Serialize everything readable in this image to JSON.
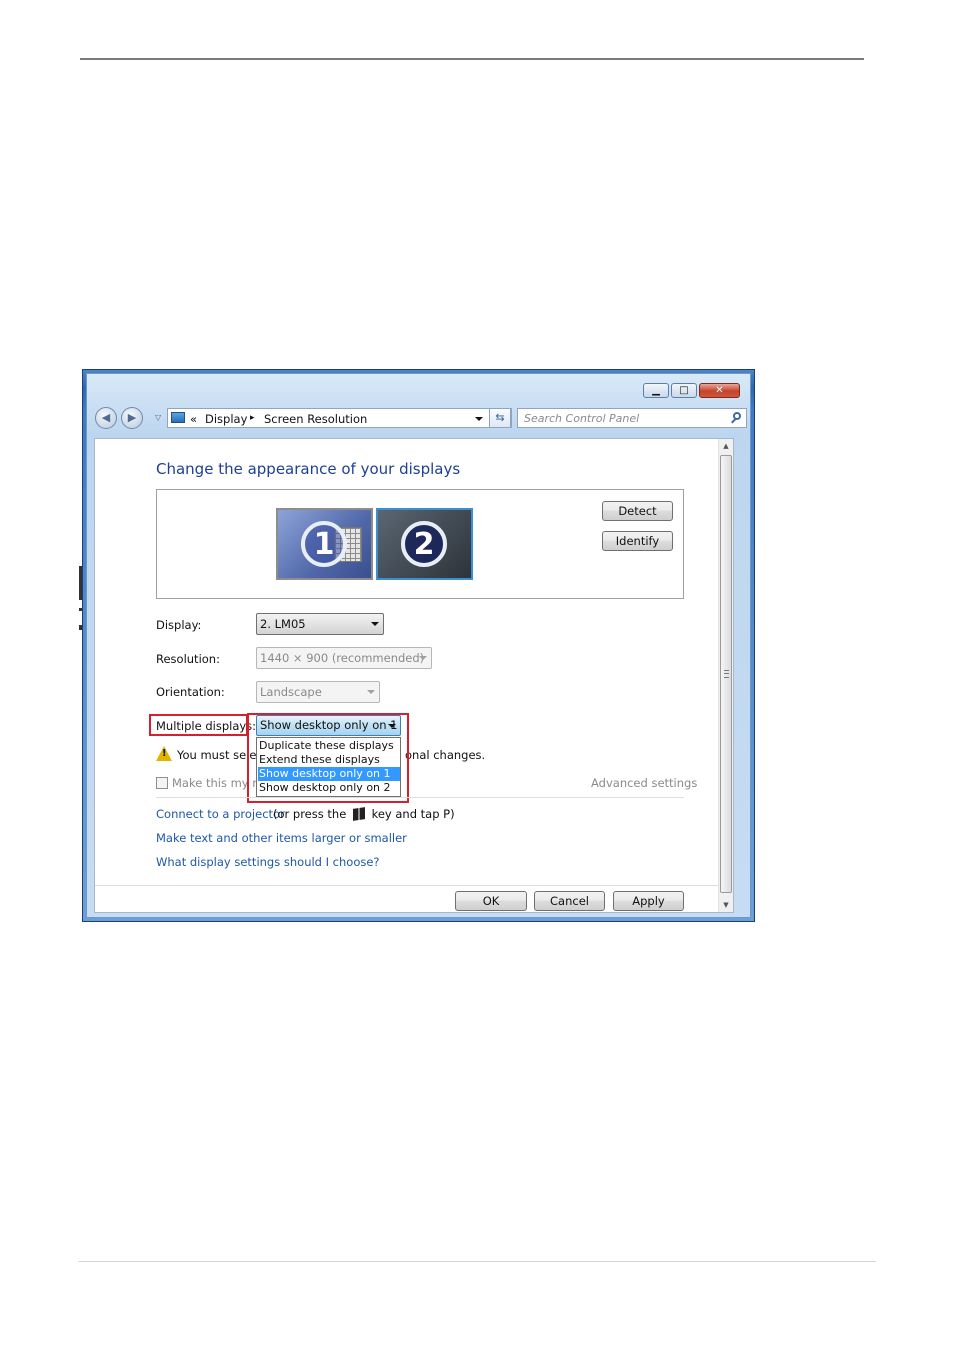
{
  "window": {
    "minimize_glyph": "▁",
    "maximize_glyph": "□",
    "close_glyph": "✕"
  },
  "navigation": {
    "back_glyph": "◀",
    "forward_glyph": "▶",
    "breadcrumb_prefix": "«",
    "breadcrumb": [
      "Display",
      "Screen Resolution"
    ],
    "separator": "▸",
    "refresh_glyph": "⇆",
    "search_placeholder": "Search Control Panel"
  },
  "main": {
    "heading": "Change the appearance of your displays",
    "monitors": [
      "1",
      "2"
    ],
    "selected_monitor": "2",
    "detect_label": "Detect",
    "identify_label": "Identify",
    "display_label": "Display:",
    "display_value": "2. LM05",
    "resolution_label": "Resolution:",
    "resolution_value": "1440 × 900 (recommended)",
    "orientation_label": "Orientation:",
    "orientation_value": "Landscape",
    "multiple_displays_label": "Multiple displays:",
    "multiple_displays_value": "Show desktop only on 1",
    "multiple_displays_options": [
      "Duplicate these displays",
      "Extend these displays",
      "Show desktop only on 1",
      "Show desktop only on 2"
    ],
    "selected_option": "Show desktop only on 1",
    "warning_text_left": "You must selec",
    "warning_text_right": "onal changes.",
    "checkbox_label": "Make this my ma",
    "advanced_settings": "Advanced settings",
    "link_projector": "Connect to a projector",
    "projector_hint_left": "(or press the",
    "projector_hint_right": "key and tap P)",
    "link_text_size": "Make text and other items larger or smaller",
    "link_help": "What display settings should I choose?"
  },
  "footer": {
    "ok_label": "OK",
    "cancel_label": "Cancel",
    "apply_label": "Apply"
  },
  "scrollbar": {
    "up_glyph": "▲",
    "down_glyph": "▼"
  },
  "colors": {
    "highlight": "#d4202f",
    "selection": "#3399ff",
    "link": "#1e57a8",
    "heading": "#1e3f95"
  }
}
